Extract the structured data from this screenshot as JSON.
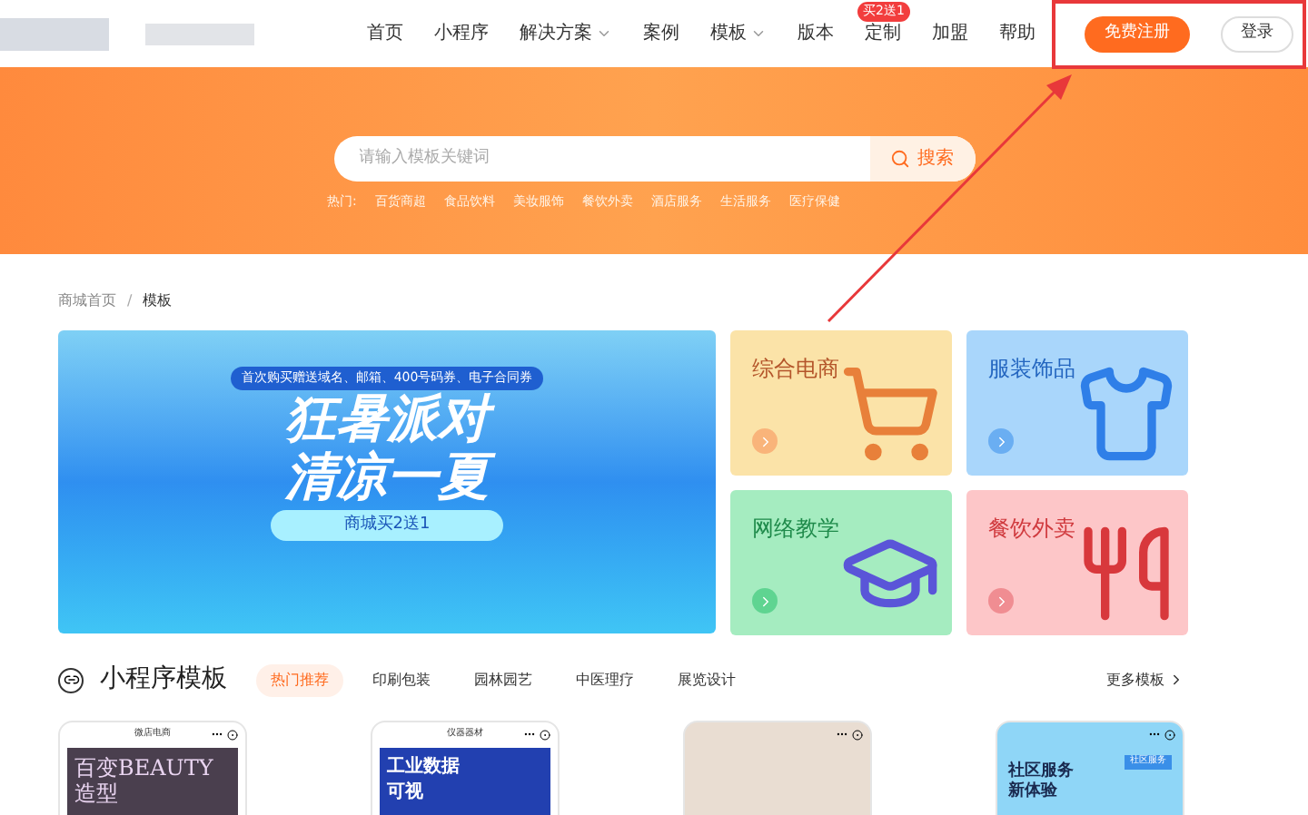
{
  "nav": {
    "items": [
      {
        "label": "首页",
        "dropdown": false
      },
      {
        "label": "小程序",
        "dropdown": false
      },
      {
        "label": "解决方案",
        "dropdown": true
      },
      {
        "label": "案例",
        "dropdown": false
      },
      {
        "label": "模板",
        "dropdown": true
      },
      {
        "label": "版本",
        "dropdown": false
      },
      {
        "label": "定制",
        "dropdown": false,
        "badge": "买2送1"
      },
      {
        "label": "加盟",
        "dropdown": false
      },
      {
        "label": "帮助",
        "dropdown": false
      }
    ],
    "register": "免费注册",
    "login": "登录"
  },
  "search": {
    "placeholder": "请输入模板关键词",
    "button": "搜索"
  },
  "hot": {
    "label": "热门:",
    "tags": [
      "百货商超",
      "食品饮料",
      "美妆服饰",
      "餐饮外卖",
      "酒店服务",
      "生活服务",
      "医疗保健"
    ]
  },
  "breadcrumb": [
    "商城首页",
    "/",
    "模板"
  ],
  "banner": {
    "tagline": "首次购买赠送域名、邮箱、400号码券、电子合同券",
    "title_lines": [
      "狂暑派对",
      "清凉一夏"
    ],
    "pill": "商城买2送1"
  },
  "categories": [
    {
      "label": "综合电商",
      "kind": "cart",
      "color": "#fbe3a8"
    },
    {
      "label": "服装饰品",
      "kind": "shirt",
      "color": "#a9d6fb"
    },
    {
      "label": "网络教学",
      "kind": "cap",
      "color": "#a5ecc0"
    },
    {
      "label": "餐饮外卖",
      "kind": "food",
      "color": "#fdc6c8"
    }
  ],
  "section": {
    "title": "小程序模板",
    "more": "更多模板",
    "tabs": [
      {
        "label": "热门推荐",
        "selected": true
      },
      {
        "label": "印刷包装",
        "selected": false
      },
      {
        "label": "园林园艺",
        "selected": false
      },
      {
        "label": "中医理疗",
        "selected": false
      },
      {
        "label": "展览设计",
        "selected": false
      }
    ]
  },
  "templates": [
    {
      "kind": "dark",
      "header": "微店电商",
      "lines": [
        "百变BEAUTY",
        "造型"
      ]
    },
    {
      "kind": "blue",
      "header": "仪器器材",
      "lines": [
        "工业数据",
        "可视"
      ]
    },
    {
      "kind": "photo"
    },
    {
      "kind": "sky",
      "badge": "社区服务",
      "lines": [
        "社区服务",
        "新体验"
      ]
    }
  ]
}
